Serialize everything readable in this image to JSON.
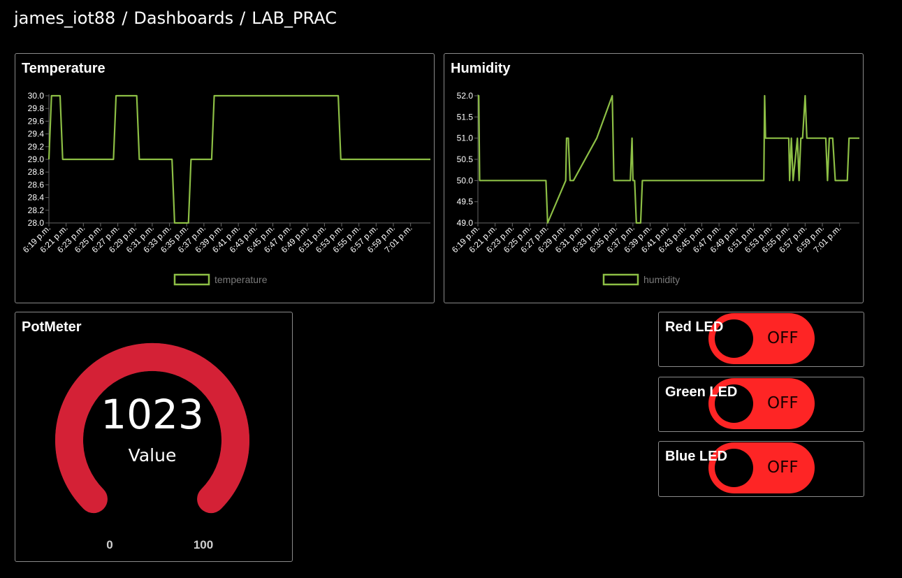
{
  "breadcrumb": {
    "user": "james_iot88",
    "section": "Dashboards",
    "dashboard": "LAB_PRAC",
    "separator": "/"
  },
  "widgets": {
    "temperature": {
      "title": "Temperature",
      "chart_data": {
        "type": "line",
        "title": "",
        "xlabel": "",
        "ylabel": "",
        "ylim": [
          28.0,
          30.0
        ],
        "yticks": [
          "30.0",
          "29.8",
          "29.6",
          "29.4",
          "29.2",
          "29.0",
          "28.8",
          "28.6",
          "28.4",
          "28.2",
          "28.0"
        ],
        "xticks": [
          "6:19 p.m.",
          "6:21 p.m.",
          "6:23 p.m.",
          "6:25 p.m.",
          "6:27 p.m.",
          "6:29 p.m.",
          "6:31 p.m.",
          "6:33 p.m.",
          "6:35 p.m.",
          "6:37 p.m.",
          "6:39 p.m.",
          "6:41 p.m.",
          "6:43 p.m.",
          "6:45 p.m.",
          "6:47 p.m.",
          "6:49 p.m.",
          "6:51 p.m.",
          "6:53 p.m.",
          "6:55 p.m.",
          "6:57 p.m.",
          "6:59 p.m.",
          "7:01 p.m."
        ],
        "xrange_minutes": [
          19,
          63.3
        ],
        "legend": "bottom",
        "grid": false,
        "series": [
          {
            "name": "temperature",
            "color": "#8dbf45",
            "x": [
              19.0,
              19.3,
              20.3,
              20.6,
              26.5,
              26.8,
              29.2,
              29.5,
              33.3,
              33.6,
              35.2,
              35.5,
              37.9,
              38.2,
              52.6,
              52.9,
              63.3
            ],
            "y": [
              29.0,
              30.0,
              30.0,
              29.0,
              29.0,
              30.0,
              30.0,
              29.0,
              29.0,
              28.0,
              28.0,
              29.0,
              29.0,
              30.0,
              30.0,
              29.0,
              29.0
            ]
          }
        ]
      }
    },
    "humidity": {
      "title": "Humidity",
      "chart_data": {
        "type": "line",
        "title": "",
        "xlabel": "",
        "ylabel": "",
        "ylim": [
          49.0,
          52.0
        ],
        "yticks": [
          "52.0",
          "51.5",
          "51.0",
          "50.5",
          "50.0",
          "49.5",
          "49.0"
        ],
        "xticks": [
          "6:19 p.m.",
          "6:21 p.m.",
          "6:23 p.m.",
          "6:25 p.m.",
          "6:27 p.m.",
          "6:29 p.m.",
          "6:31 p.m.",
          "6:33 p.m.",
          "6:35 p.m.",
          "6:37 p.m.",
          "6:39 p.m.",
          "6:41 p.m.",
          "6:43 p.m.",
          "6:45 p.m.",
          "6:47 p.m.",
          "6:49 p.m.",
          "6:51 p.m.",
          "6:53 p.m.",
          "6:55 p.m.",
          "6:57 p.m.",
          "6:59 p.m.",
          "7:01 p.m."
        ],
        "xrange_minutes": [
          19,
          63.3
        ],
        "legend": "bottom",
        "grid": false,
        "series": [
          {
            "name": "humidity",
            "color": "#8dbf45",
            "x": [
              19.0,
              19.1,
              19.2,
              26.9,
              27.1,
              29.2,
              29.3,
              29.5,
              29.7,
              30.1,
              32.8,
              34.6,
              34.8,
              36.7,
              36.9,
              37.0,
              37.2,
              37.4,
              37.9,
              38.1,
              52.2,
              52.3,
              52.4,
              55.1,
              55.2,
              55.4,
              55.6,
              56.1,
              56.3,
              56.5,
              56.7,
              57.0,
              57.2,
              59.4,
              59.6,
              59.8,
              60.2,
              60.5,
              60.7,
              61.9,
              62.1,
              62.6,
              63.3
            ],
            "y": [
              52.0,
              52.0,
              50.0,
              50.0,
              49.0,
              50.0,
              51.0,
              51.0,
              50.0,
              50.0,
              51.0,
              52.0,
              50.0,
              50.0,
              51.0,
              50.0,
              50.0,
              49.0,
              49.0,
              50.0,
              50.0,
              52.0,
              51.0,
              51.0,
              50.0,
              51.0,
              50.0,
              51.0,
              50.0,
              51.0,
              51.0,
              52.0,
              51.0,
              51.0,
              50.0,
              51.0,
              51.0,
              50.0,
              50.0,
              50.0,
              51.0,
              51.0,
              51.0
            ]
          }
        ]
      }
    },
    "potmeter": {
      "title": "PotMeter",
      "value": "1023",
      "label": "Value",
      "min": "0",
      "max": "100",
      "fraction": 1.0,
      "color": "#d42136"
    }
  },
  "leds": [
    {
      "label": "Red LED",
      "state": "OFF"
    },
    {
      "label": "Green LED",
      "state": "OFF"
    },
    {
      "label": "Blue LED",
      "state": "OFF"
    }
  ],
  "colors": {
    "line": "#8dbf45",
    "toggle": "#fe2525",
    "gauge": "#d42136",
    "border": "#8a8a8a"
  }
}
